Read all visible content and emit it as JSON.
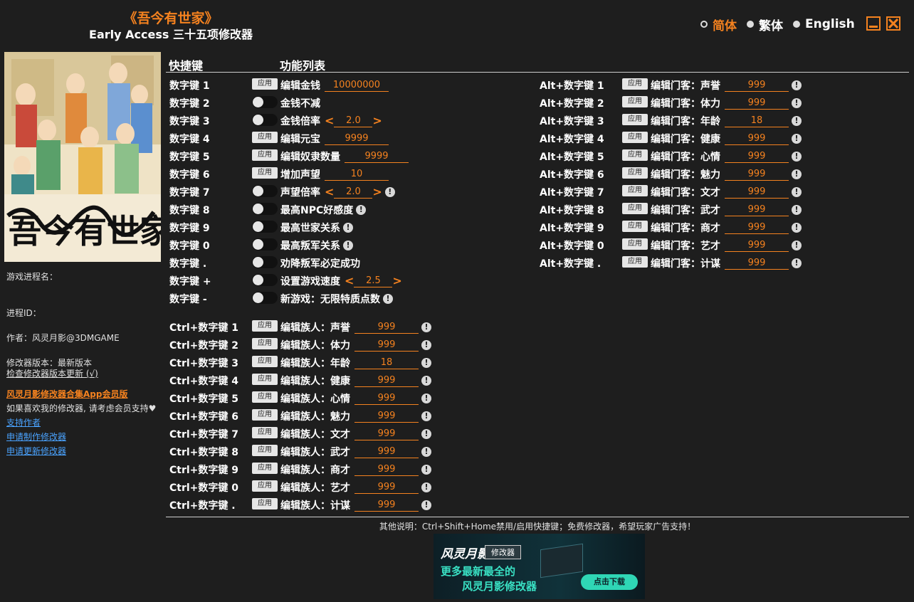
{
  "header": {
    "title": "《吾今有世家》",
    "subtitle": "Early Access 三十五项修改器"
  },
  "languages": [
    {
      "label": "简体",
      "selected": true
    },
    {
      "label": "繁体",
      "selected": false
    },
    {
      "label": "English",
      "selected": false
    }
  ],
  "cover": {
    "logo_text": "吾今有世家"
  },
  "sidebar": {
    "process_name_label": "游戏进程名：",
    "process_id_label": "进程ID：",
    "author": "作者：风灵月影@3DMGAME",
    "version": "修改器版本：最新版本",
    "check_update": "检查修改器版本更新 (√)",
    "vip_link": "风灵月影修改器合集App会员版",
    "support_text": "如果喜欢我的修改器, 请考虑会员支持♥",
    "support_author": "支持作者",
    "request_make": "申请制作修改器",
    "request_update": "申请更新修改器"
  },
  "columns": {
    "hotkey": "快捷键",
    "features": "功能列表"
  },
  "apply_label": "应用",
  "warn_symbol": "!",
  "arrows": {
    "left": "<",
    "right": ">"
  },
  "col1": [
    {
      "key": "数字键 1",
      "ctl": "apply",
      "label": "编辑金钱",
      "value": "10000000",
      "vw": 90
    },
    {
      "key": "数字键 2",
      "ctl": "toggle",
      "label": "金钱不减"
    },
    {
      "key": "数字键 3",
      "ctl": "toggle",
      "label": "金钱倍率",
      "stepper": "2.0"
    },
    {
      "key": "数字键 4",
      "ctl": "apply",
      "label": "编辑元宝",
      "value": "9999",
      "vw": 90
    },
    {
      "key": "数字键 5",
      "ctl": "apply",
      "label": "编辑奴隶数量",
      "value": "9999",
      "vw": 90
    },
    {
      "key": "数字键 6",
      "ctl": "apply",
      "label": "增加声望",
      "value": "10",
      "vw": 90
    },
    {
      "key": "数字键 7",
      "ctl": "toggle",
      "label": "声望倍率",
      "stepper": "2.0",
      "warn": true
    },
    {
      "key": "数字键 8",
      "ctl": "toggle",
      "label": "最高NPC好感度",
      "warn": true
    },
    {
      "key": "数字键 9",
      "ctl": "toggle",
      "label": "最高世家关系",
      "warn": true
    },
    {
      "key": "数字键 0",
      "ctl": "toggle",
      "label": "最高叛军关系",
      "warn": true
    },
    {
      "key": "数字键 .",
      "ctl": "toggle",
      "label": "劝降叛军必定成功"
    },
    {
      "key": "数字键 +",
      "ctl": "toggle",
      "label": "设置游戏速度",
      "stepper": "2.5"
    },
    {
      "key": "数字键 -",
      "ctl": "toggle",
      "label": "新游戏：无限特质点数",
      "warn": true
    }
  ],
  "col2": [
    {
      "key": "Ctrl+数字键 1",
      "label": "编辑族人：声誉",
      "value": "999"
    },
    {
      "key": "Ctrl+数字键 2",
      "label": "编辑族人：体力",
      "value": "999"
    },
    {
      "key": "Ctrl+数字键 3",
      "label": "编辑族人：年龄",
      "value": "18"
    },
    {
      "key": "Ctrl+数字键 4",
      "label": "编辑族人：健康",
      "value": "999"
    },
    {
      "key": "Ctrl+数字键 5",
      "label": "编辑族人：心情",
      "value": "999"
    },
    {
      "key": "Ctrl+数字键 6",
      "label": "编辑族人：魅力",
      "value": "999"
    },
    {
      "key": "Ctrl+数字键 7",
      "label": "编辑族人：文才",
      "value": "999"
    },
    {
      "key": "Ctrl+数字键 8",
      "label": "编辑族人：武才",
      "value": "999"
    },
    {
      "key": "Ctrl+数字键 9",
      "label": "编辑族人：商才",
      "value": "999"
    },
    {
      "key": "Ctrl+数字键 0",
      "label": "编辑族人：艺才",
      "value": "999"
    },
    {
      "key": "Ctrl+数字键 .",
      "label": "编辑族人：计谋",
      "value": "999"
    }
  ],
  "col3": [
    {
      "key": "Alt+数字键 1",
      "label": "编辑门客：声誉",
      "value": "999"
    },
    {
      "key": "Alt+数字键 2",
      "label": "编辑门客：体力",
      "value": "999"
    },
    {
      "key": "Alt+数字键 3",
      "label": "编辑门客：年龄",
      "value": "18"
    },
    {
      "key": "Alt+数字键 4",
      "label": "编辑门客：健康",
      "value": "999"
    },
    {
      "key": "Alt+数字键 5",
      "label": "编辑门客：心情",
      "value": "999"
    },
    {
      "key": "Alt+数字键 6",
      "label": "编辑门客：魅力",
      "value": "999"
    },
    {
      "key": "Alt+数字键 7",
      "label": "编辑门客：文才",
      "value": "999"
    },
    {
      "key": "Alt+数字键 8",
      "label": "编辑门客：武才",
      "value": "999"
    },
    {
      "key": "Alt+数字键 9",
      "label": "编辑门客：商才",
      "value": "999"
    },
    {
      "key": "Alt+数字键 0",
      "label": "编辑门客：艺才",
      "value": "999"
    },
    {
      "key": "Alt+数字键 .",
      "label": "编辑门客：计谋",
      "value": "999"
    }
  ],
  "footer": {
    "note": "其他说明：Ctrl+Shift+Home禁用/启用快捷键；免费修改器，希望玩家广告支持！"
  },
  "ad": {
    "brand": "风灵月影",
    "tag": "修改器",
    "line1": "更多最新最全的",
    "line2": "风灵月影修改器",
    "download": "点击下载"
  },
  "colors": {
    "accent": "#f5821f",
    "background": "#1e1e1e",
    "link": "#4aa3ff",
    "ad_teal": "#39e0c3"
  }
}
